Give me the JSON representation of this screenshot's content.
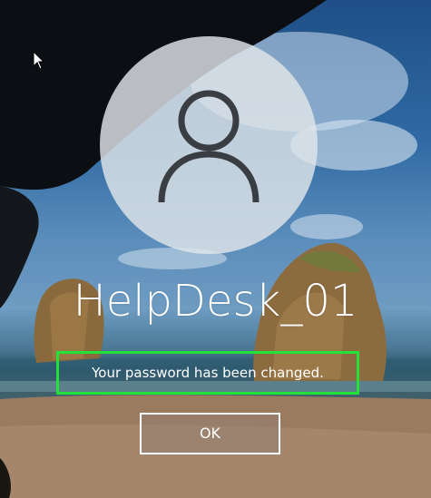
{
  "user": {
    "name": "HelpDesk_01"
  },
  "dialog": {
    "message": "Your password has been changed.",
    "ok_label": "OK"
  },
  "colors": {
    "highlight_border": "#22e23a",
    "text": "#ffffff",
    "avatar_fill": "#e1e5e9",
    "avatar_glyph": "#3a3d42"
  },
  "icons": {
    "avatar": "user-silhouette-icon",
    "pointer": "mouse-cursor-icon"
  }
}
